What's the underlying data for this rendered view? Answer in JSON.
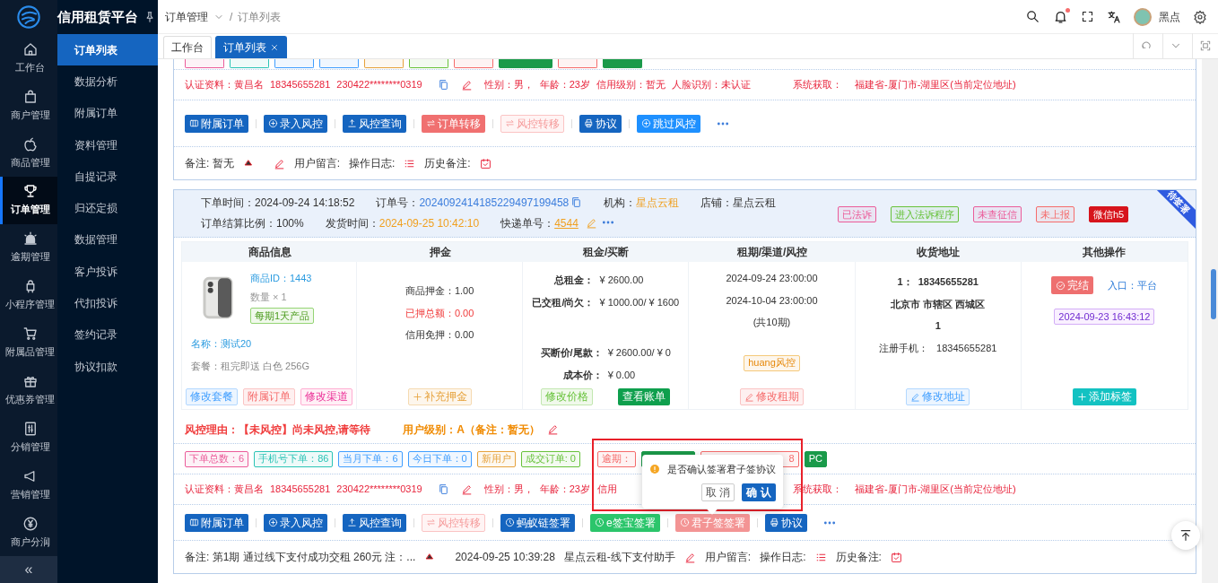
{
  "brand": {
    "title": "信用租赁平台"
  },
  "rail": [
    {
      "label": "工作台",
      "selected": false
    },
    {
      "label": "商户管理",
      "selected": false
    },
    {
      "label": "商品管理",
      "selected": false
    },
    {
      "label": "订单管理",
      "selected": true
    },
    {
      "label": "逾期管理",
      "selected": false
    },
    {
      "label": "小程序管理",
      "selected": false
    },
    {
      "label": "附属品管理",
      "selected": false
    },
    {
      "label": "优惠券管理",
      "selected": false
    },
    {
      "label": "分销管理",
      "selected": false
    },
    {
      "label": "营销管理",
      "selected": false
    },
    {
      "label": "商户分润",
      "selected": false
    }
  ],
  "rail_collapse": "«",
  "submenu": [
    {
      "label": "订单列表",
      "selected": true
    },
    {
      "label": "数据分析",
      "selected": false
    },
    {
      "label": "附属订单",
      "selected": false
    },
    {
      "label": "资料管理",
      "selected": false
    },
    {
      "label": "自提记录",
      "selected": false
    },
    {
      "label": "归还定损",
      "selected": false
    },
    {
      "label": "数据管理",
      "selected": false
    },
    {
      "label": "客户投诉",
      "selected": false
    },
    {
      "label": "代扣投诉",
      "selected": false
    },
    {
      "label": "签约记录",
      "selected": false
    },
    {
      "label": "协议扣款",
      "selected": false
    }
  ],
  "breadcrumb": [
    "订单管理",
    "订单列表"
  ],
  "breadcrumb_separator": "/",
  "user": {
    "name": "黑点",
    "unread": true
  },
  "tabs": [
    {
      "label": "工作台",
      "selected": false,
      "closable": false
    },
    {
      "label": "订单列表",
      "selected": true,
      "closable": true
    }
  ],
  "orders": [
    {
      "tags": [
        {
          "kind": "outline",
          "color": "#eb5c9a"
        },
        {
          "kind": "outline",
          "color": "#2bc4b6"
        },
        {
          "kind": "outline",
          "color": "#409eff"
        },
        {
          "kind": "outline",
          "color": "#409eff"
        },
        {
          "kind": "outline",
          "color": "#e6a23c"
        },
        {
          "kind": "outline",
          "color": "#67c23a"
        },
        {
          "kind": "outline",
          "color": "#f56c6c"
        },
        {
          "kind": "solid",
          "color": "#1a9a4a"
        },
        {
          "kind": "outline",
          "color": "#f56c6c"
        },
        {
          "kind": "solid",
          "color": "#1a9a4a"
        }
      ],
      "auth": {
        "label": "认证资料：",
        "name": "黄昌名",
        "phone": "18345655281",
        "id_number": "230422********0319",
        "fields": [
          "性别：男，",
          "年龄：23岁",
          "信用级别：暂无",
          "人脸识别：未认证"
        ],
        "location_label": "系统获取：",
        "location": "福建省-厦门市-湖里区(当前定位地址)"
      },
      "actions": [
        {
          "label": "附属订单",
          "kind": "primary"
        },
        {
          "label": "录入风控",
          "kind": "primary"
        },
        {
          "label": "风控查询",
          "kind": "primary"
        },
        {
          "label": "订单转移",
          "kind": "danger"
        },
        {
          "label": "风控转移",
          "kind": "danger-plain"
        },
        {
          "label": "协议",
          "kind": "primary"
        },
        {
          "label": "跳过风控",
          "kind": "info"
        }
      ],
      "remark": {
        "text": "备注: 暂无",
        "message_label": "用户留言:",
        "log_label": "操作日志:",
        "history_label": "历史备注:"
      }
    },
    {
      "status_ribbon": "待签署",
      "header": {
        "fields": [
          {
            "label": "下单时间：",
            "value": "2024-09-24 14:18:52",
            "kind": "plain"
          },
          {
            "label": "订单号：",
            "value": "2024092414185229497199458",
            "kind": "link"
          },
          {
            "label": "机构：",
            "value": "星点云租",
            "kind": "highlight"
          },
          {
            "label": "店铺：",
            "value": "星点云租",
            "kind": "plain"
          },
          {
            "label": "订单结算比例：",
            "value": "100%",
            "kind": "plain"
          },
          {
            "label": "发货时间：",
            "value": "2024-09-25 10:42:10",
            "kind": "highlight"
          },
          {
            "label": "快递单号：",
            "value": "4544",
            "kind": "tracking"
          }
        ],
        "badges": [
          {
            "text": "已法诉",
            "kind": "outline",
            "color": "#eb5c9a"
          },
          {
            "text": "进入法诉程序",
            "kind": "outline",
            "color": "#67c23a"
          },
          {
            "text": "未查征信",
            "kind": "outline",
            "color": "#eb5c9a"
          },
          {
            "text": "未上报",
            "kind": "outline",
            "color": "#f56c6c"
          },
          {
            "text": "微信h5",
            "kind": "solid",
            "color": "#d7141c"
          }
        ]
      },
      "table": {
        "columns": [
          "商品信息",
          "押金",
          "租金/买断",
          "租期/渠道/风控",
          "收货地址",
          "其他操作"
        ],
        "cells": [
          {
            "kind": "goods",
            "id": "商品ID：1443",
            "quantity": "数量 × 1",
            "period_tag": "每期1天产品",
            "name": "名称：测试20",
            "package": "套餐：租完即送 白色 256G",
            "buttons": [
              {
                "label": "修改套餐",
                "kind": "plain-blue"
              },
              {
                "label": "附属订单",
                "kind": "plain-red"
              },
              {
                "label": "修改渠道",
                "kind": "plain-pink"
              }
            ]
          },
          {
            "kind": "deposit",
            "lines": [
              {
                "text": "商品押金：1.00",
                "alert": false
              },
              {
                "text": "已押总额：0.00",
                "alert": true
              },
              {
                "text": "信用免押：0.00",
                "alert": false
              }
            ],
            "buttons": [
              {
                "label": "补充押金",
                "kind": "plain-orange"
              }
            ]
          },
          {
            "kind": "rent",
            "groups": [
              [
                {
                  "label": "总租金：",
                  "value": "¥ 2600.00"
                },
                {
                  "label": "已交租/尚欠：",
                  "value": "¥ 1000.00/ ¥ 1600"
                }
              ],
              [
                {
                  "label": "买断价/尾款：",
                  "value": "¥ 2600.00/ ¥ 0"
                },
                {
                  "label": "成本价：",
                  "value": "¥ 0.00"
                }
              ]
            ],
            "buttons": [
              {
                "label": "修改价格",
                "kind": "plain-green"
              },
              {
                "label": "查看账单",
                "kind": "solid-green"
              }
            ]
          },
          {
            "kind": "term",
            "lines": [
              "2024-09-24 23:00:00",
              "2024-10-04 23:00:00",
              "(共10期)"
            ],
            "risk_tag": "huang风控",
            "buttons": [
              {
                "label": "修改租期",
                "kind": "plain-red"
              }
            ]
          },
          {
            "kind": "address",
            "lines": [
              "1：  18345655281",
              "北京市 市辖区 西城区",
              "1"
            ],
            "phone": "注册手机：   18345655281",
            "buttons": [
              {
                "label": "修改地址",
                "kind": "plain-blue"
              }
            ]
          },
          {
            "kind": "other",
            "status_button": "完结",
            "entry": "入口：平台",
            "time_tag": "2024-09-23 16:43:12",
            "buttons": [
              {
                "label": "添加标签",
                "kind": "solid-teal"
              }
            ]
          }
        ]
      },
      "risk": {
        "reason": "风控理由：【未风控】尚未风控,请等待",
        "level": "用户级别：A（备注：暂无）"
      },
      "tags": [
        {
          "text": "下单总数：6",
          "kind": "outline",
          "color": "#eb5c9a"
        },
        {
          "text": "手机号下单：86",
          "kind": "outline",
          "color": "#2bc4b6"
        },
        {
          "text": "当月下单：6",
          "kind": "outline",
          "color": "#409eff"
        },
        {
          "text": "今日下单：0",
          "kind": "outline",
          "color": "#409eff"
        },
        {
          "text": "新用户",
          "kind": "outline",
          "color": "#e6a23c"
        },
        {
          "text": "成交订单: 0",
          "kind": "outline",
          "color": "#67c23a"
        },
        {
          "text": "逾期：",
          "kind": "outline",
          "color": "#f56c6c"
        },
        {
          "kind": "solid",
          "color": "#1a9a4a",
          "covered": true
        },
        {
          "text": "8",
          "kind": "outline",
          "color": "#f56c6c",
          "covered": true
        },
        {
          "text": "PC",
          "kind": "solid",
          "color": "#1a9a4a"
        }
      ],
      "auth": {
        "label": "认证资料：",
        "name": "黄昌名",
        "phone": "18345655281",
        "id_number": "230422********0319",
        "fields": [
          "性别：男，",
          "年龄：23岁",
          "信用"
        ],
        "location_label": "系统获取：",
        "location": "福建省-厦门市-湖里区(当前定位地址)"
      },
      "actions": [
        {
          "label": "附属订单",
          "kind": "primary"
        },
        {
          "label": "录入风控",
          "kind": "primary"
        },
        {
          "label": "风控查询",
          "kind": "primary"
        },
        {
          "label": "风控转移",
          "kind": "danger-plain"
        },
        {
          "label": "蚂蚁链签署",
          "kind": "primary"
        },
        {
          "label": "e签宝签署",
          "kind": "success"
        },
        {
          "label": "君子签签署",
          "kind": "danger-light"
        },
        {
          "label": "协议",
          "kind": "primary"
        }
      ],
      "remark": {
        "text": "备注: 第1期 通过线下支付成功交租 260元 注：...",
        "time": "2024-09-25 10:39:28",
        "operator": "星点云租-线下支付助手",
        "message_label": "用户留言:",
        "log_label": "操作日志:",
        "history_label": "历史备注:"
      }
    }
  ],
  "popover": {
    "message": "是否确认签署君子签协议",
    "cancel": "取 消",
    "confirm": "确 认"
  }
}
